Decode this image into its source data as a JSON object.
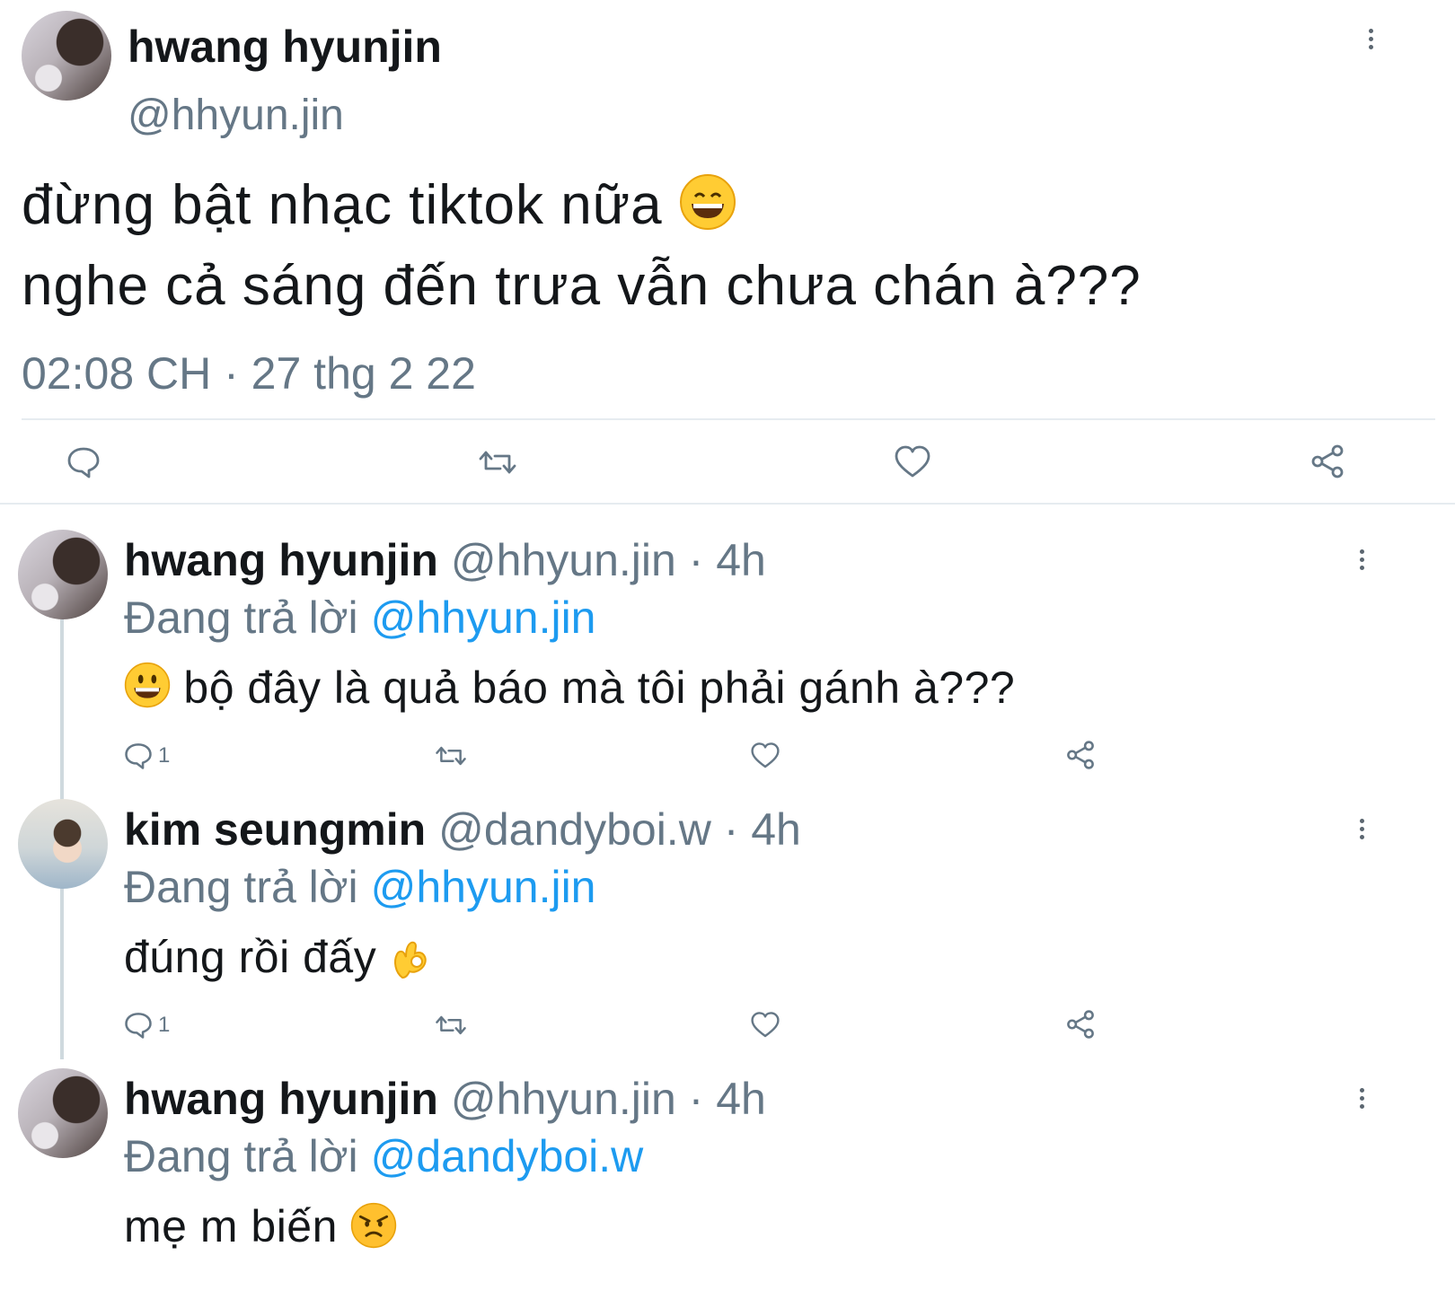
{
  "main_tweet": {
    "display_name": "hwang hyunjin",
    "handle": "@hhyun.jin",
    "line1": "đừng bật nhạc tiktok nữa",
    "line2": "nghe cả sáng đến trưa vẫn chưa chán à???",
    "timestamp": "02:08 CH · 27 thg 2 22",
    "emoji": "grinning-face-smiling-eyes"
  },
  "replies": [
    {
      "display_name": "hwang hyunjin",
      "meta": "@hhyun.jin · 4h",
      "replying_prefix": "Đang trả lời",
      "replying_to": "@hhyun.jin",
      "text": "bộ đây là quả báo mà tôi phải gánh à???",
      "emoji": "smiling-face-open-mouth",
      "reply_count": "1"
    },
    {
      "display_name": "kim seungmin",
      "meta": "@dandyboi.w · 4h",
      "replying_prefix": "Đang trả lời",
      "replying_to": "@hhyun.jin",
      "text": "đúng rồi đấy",
      "emoji": "ok-hand",
      "reply_count": "1"
    },
    {
      "display_name": "hwang hyunjin",
      "meta": "@hhyun.jin · 4h",
      "replying_prefix": "Đang trả lời",
      "replying_to": "@dandyboi.w",
      "text": "mẹ m biến",
      "emoji": "angry-face"
    }
  ],
  "colors": {
    "accent": "#1d9bf0",
    "muted": "#657786",
    "text": "#14171a",
    "divider": "#e6ecf0"
  }
}
